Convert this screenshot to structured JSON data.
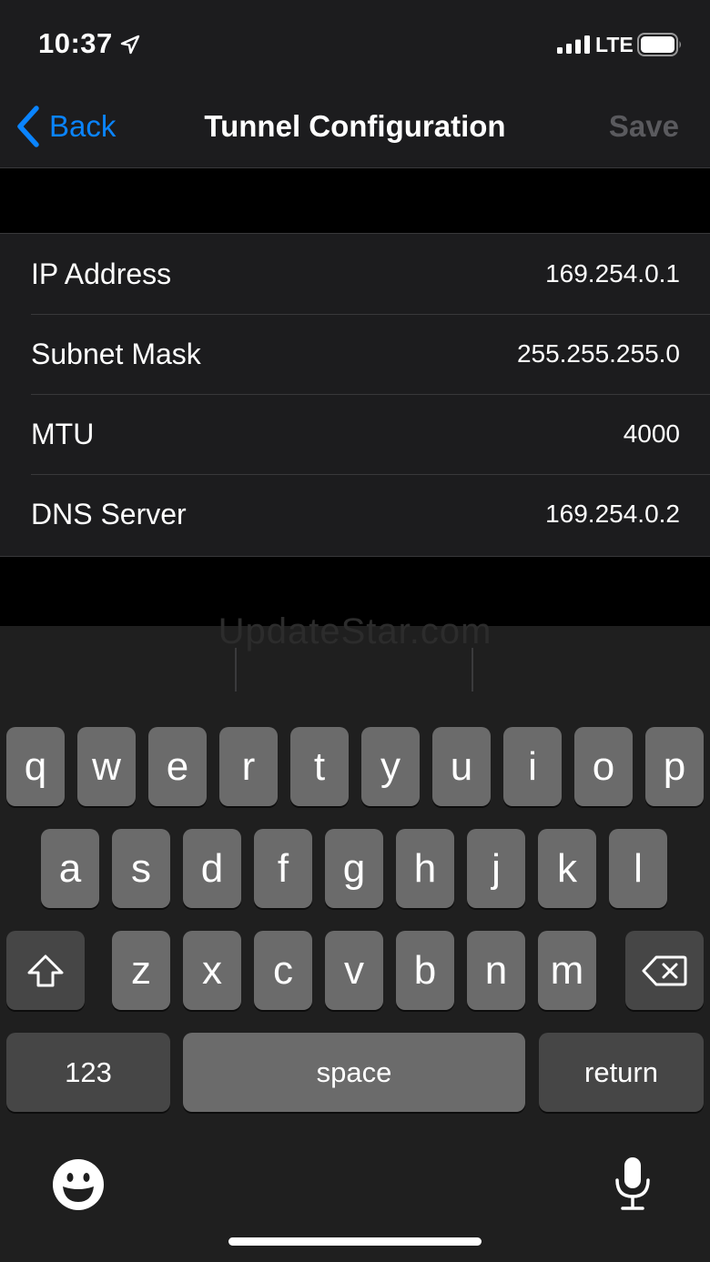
{
  "status_bar": {
    "time": "10:37",
    "network": "LTE",
    "icons": [
      "location-arrow-icon",
      "cellular-signal-icon",
      "battery-icon"
    ]
  },
  "nav": {
    "back_label": "Back",
    "title": "Tunnel Configuration",
    "save_label": "Save",
    "accent_color": "#0a84ff",
    "save_disabled_color": "#5a5a5e"
  },
  "fields": [
    {
      "label": "IP Address",
      "value": "169.254.0.1"
    },
    {
      "label": "Subnet Mask",
      "value": "255.255.255.0"
    },
    {
      "label": "MTU",
      "value": "4000"
    },
    {
      "label": "DNS Server",
      "value": "169.254.0.2"
    }
  ],
  "watermark": "UpdateStar.com",
  "keyboard": {
    "row1": [
      "q",
      "w",
      "e",
      "r",
      "t",
      "y",
      "u",
      "i",
      "o",
      "p"
    ],
    "row2": [
      "a",
      "s",
      "d",
      "f",
      "g",
      "h",
      "j",
      "k",
      "l"
    ],
    "row3": [
      "z",
      "x",
      "c",
      "v",
      "b",
      "n",
      "m"
    ],
    "numbers_label": "123",
    "space_label": "space",
    "return_label": "return",
    "icons": [
      "shift-icon",
      "delete-icon",
      "emoji-icon",
      "microphone-icon"
    ]
  }
}
